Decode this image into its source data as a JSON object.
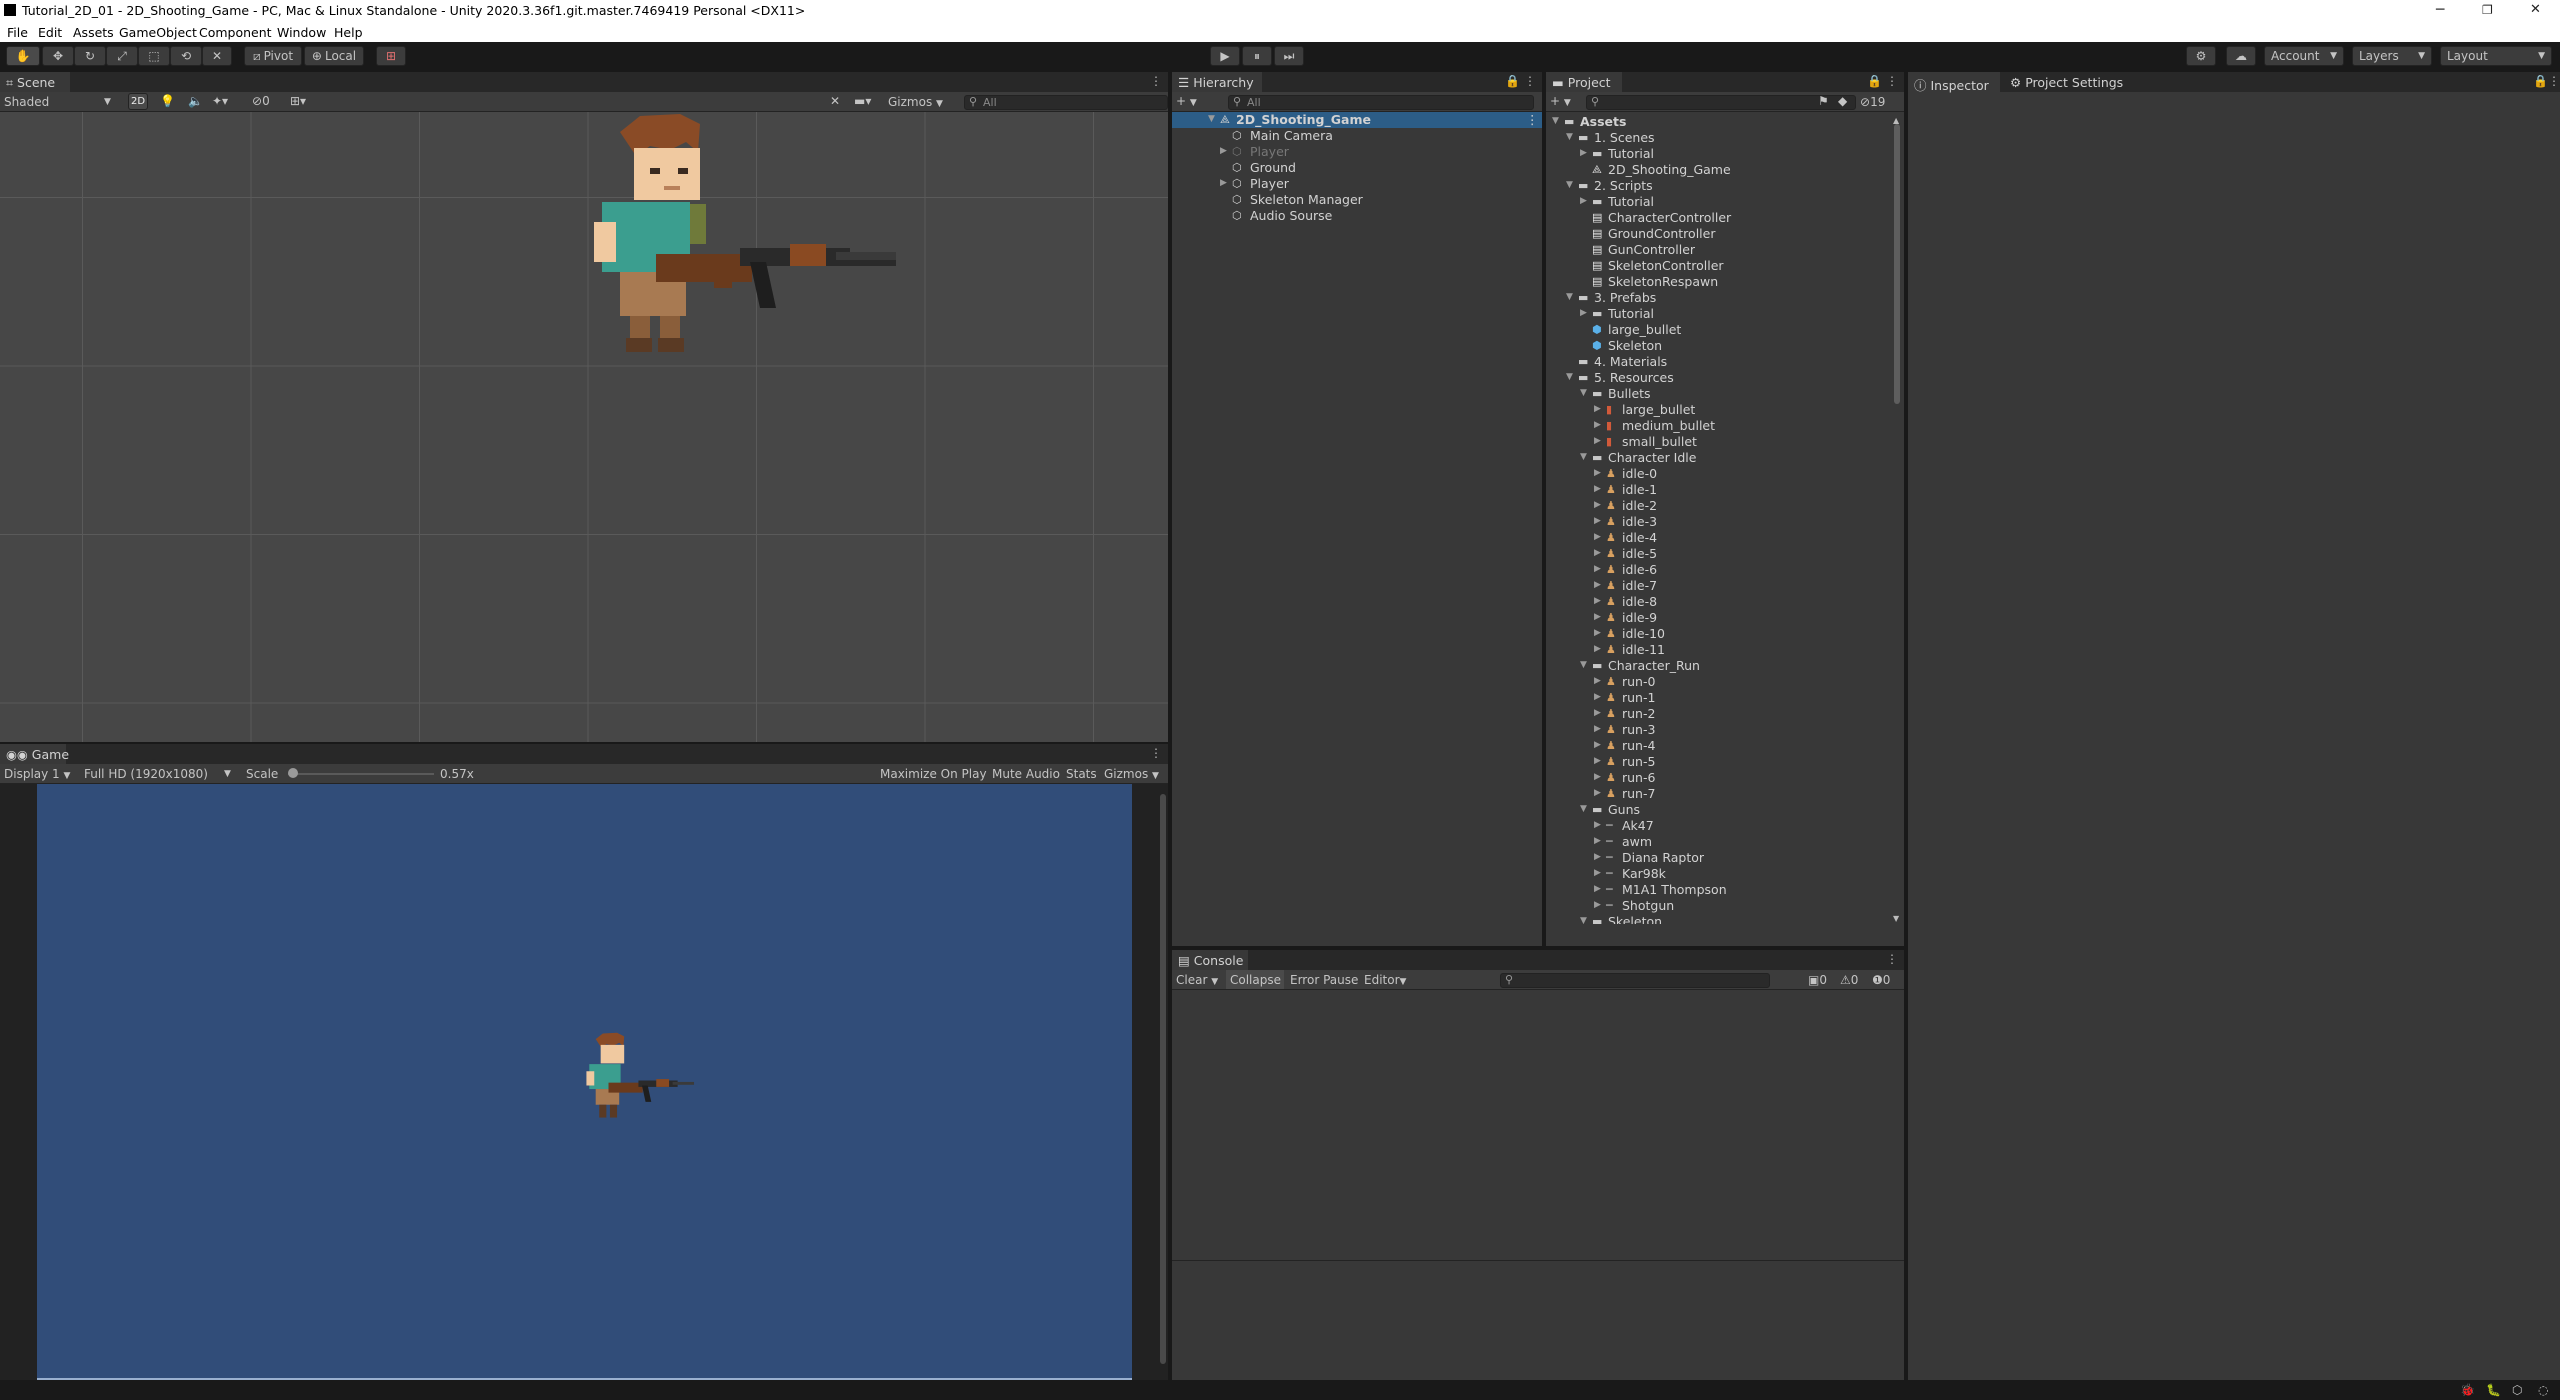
{
  "window": {
    "title": "Tutorial_2D_01 - 2D_Shooting_Game - PC, Mac & Linux Standalone - Unity 2020.3.36f1.git.master.7469419 Personal <DX11>",
    "minimize": "─",
    "restore": "❐",
    "close": "✕"
  },
  "menu": [
    "File",
    "Edit",
    "Assets",
    "GameObject",
    "Component",
    "Window",
    "Help"
  ],
  "toolbar": {
    "tools": [
      "hand-icon",
      "move-icon",
      "rotate-icon",
      "scale-icon",
      "rect-icon",
      "transform-icon",
      "custom-tool-icon"
    ],
    "pivot": "Pivot",
    "local": "Local",
    "grid_snap_icon": "grid-snap-icon",
    "play": "▶",
    "pause": "⏸",
    "step": "⏭",
    "account": "Account",
    "layers": "Layers",
    "layout": "Layout"
  },
  "scene": {
    "tab": "Scene",
    "shading": "Shaded",
    "mode_2d": "2D",
    "hidden_count": "0",
    "gizmos": "Gizmos",
    "search_placeholder": "All"
  },
  "game": {
    "tab": "Game",
    "display": "Display 1",
    "resolution": "Full HD (1920x1080)",
    "scale_label": "Scale",
    "scale_value": "0.57x",
    "maximize": "Maximize On Play",
    "mute": "Mute Audio",
    "stats": "Stats",
    "gizmos": "Gizmos",
    "bg_color": "#314d79"
  },
  "hierarchy": {
    "tab": "Hierarchy",
    "search_placeholder": "All",
    "scene_name": "2D_Shooting_Game",
    "items": [
      {
        "label": "Main Camera",
        "expand": false,
        "dim": false
      },
      {
        "label": "Player",
        "expand": true,
        "dim": true
      },
      {
        "label": "Ground",
        "expand": false,
        "dim": false
      },
      {
        "label": "Player",
        "expand": true,
        "dim": false
      },
      {
        "label": "Skeleton Manager",
        "expand": false,
        "dim": false
      },
      {
        "label": "Audio Sourse",
        "expand": false,
        "dim": false
      }
    ]
  },
  "project": {
    "tab": "Project",
    "hidden_count": "19",
    "tree": [
      {
        "d": 0,
        "a": "▼",
        "i": "folder",
        "t": "Assets",
        "b": true
      },
      {
        "d": 1,
        "a": "▼",
        "i": "folder",
        "t": "1. Scenes"
      },
      {
        "d": 2,
        "a": "▶",
        "i": "folder",
        "t": "Tutorial"
      },
      {
        "d": 2,
        "a": "",
        "i": "scene",
        "t": "2D_Shooting_Game"
      },
      {
        "d": 1,
        "a": "▼",
        "i": "folder",
        "t": "2. Scripts"
      },
      {
        "d": 2,
        "a": "▶",
        "i": "folder",
        "t": "Tutorial"
      },
      {
        "d": 2,
        "a": "",
        "i": "script",
        "t": "CharacterController"
      },
      {
        "d": 2,
        "a": "",
        "i": "script",
        "t": "GroundController"
      },
      {
        "d": 2,
        "a": "",
        "i": "script",
        "t": "GunController"
      },
      {
        "d": 2,
        "a": "",
        "i": "script",
        "t": "SkeletonController"
      },
      {
        "d": 2,
        "a": "",
        "i": "script",
        "t": "SkeletonRespawn"
      },
      {
        "d": 1,
        "a": "▼",
        "i": "folder",
        "t": "3. Prefabs"
      },
      {
        "d": 2,
        "a": "▶",
        "i": "folder",
        "t": "Tutorial"
      },
      {
        "d": 2,
        "a": "",
        "i": "prefab",
        "t": "large_bullet"
      },
      {
        "d": 2,
        "a": "",
        "i": "prefab",
        "t": "Skeleton"
      },
      {
        "d": 1,
        "a": "",
        "i": "folder",
        "t": "4. Materials"
      },
      {
        "d": 1,
        "a": "▼",
        "i": "folder",
        "t": "5. Resources"
      },
      {
        "d": 2,
        "a": "▼",
        "i": "folder",
        "t": "Bullets"
      },
      {
        "d": 3,
        "a": "▶",
        "i": "bullet",
        "t": "large_bullet"
      },
      {
        "d": 3,
        "a": "▶",
        "i": "bullet",
        "t": "medium_bullet"
      },
      {
        "d": 3,
        "a": "▶",
        "i": "bullet",
        "t": "small_bullet"
      },
      {
        "d": 2,
        "a": "▼",
        "i": "folder",
        "t": "Character Idle"
      },
      {
        "d": 3,
        "a": "▶",
        "i": "sprite",
        "t": "idle-0"
      },
      {
        "d": 3,
        "a": "▶",
        "i": "sprite",
        "t": "idle-1"
      },
      {
        "d": 3,
        "a": "▶",
        "i": "sprite",
        "t": "idle-2"
      },
      {
        "d": 3,
        "a": "▶",
        "i": "sprite",
        "t": "idle-3"
      },
      {
        "d": 3,
        "a": "▶",
        "i": "sprite",
        "t": "idle-4"
      },
      {
        "d": 3,
        "a": "▶",
        "i": "sprite",
        "t": "idle-5"
      },
      {
        "d": 3,
        "a": "▶",
        "i": "sprite",
        "t": "idle-6"
      },
      {
        "d": 3,
        "a": "▶",
        "i": "sprite",
        "t": "idle-7"
      },
      {
        "d": 3,
        "a": "▶",
        "i": "sprite",
        "t": "idle-8"
      },
      {
        "d": 3,
        "a": "▶",
        "i": "sprite",
        "t": "idle-9"
      },
      {
        "d": 3,
        "a": "▶",
        "i": "sprite",
        "t": "idle-10"
      },
      {
        "d": 3,
        "a": "▶",
        "i": "sprite",
        "t": "idle-11"
      },
      {
        "d": 2,
        "a": "▼",
        "i": "folder",
        "t": "Character_Run"
      },
      {
        "d": 3,
        "a": "▶",
        "i": "sprite",
        "t": "run-0"
      },
      {
        "d": 3,
        "a": "▶",
        "i": "sprite",
        "t": "run-1"
      },
      {
        "d": 3,
        "a": "▶",
        "i": "sprite",
        "t": "run-2"
      },
      {
        "d": 3,
        "a": "▶",
        "i": "sprite",
        "t": "run-3"
      },
      {
        "d": 3,
        "a": "▶",
        "i": "sprite",
        "t": "run-4"
      },
      {
        "d": 3,
        "a": "▶",
        "i": "sprite",
        "t": "run-5"
      },
      {
        "d": 3,
        "a": "▶",
        "i": "sprite",
        "t": "run-6"
      },
      {
        "d": 3,
        "a": "▶",
        "i": "sprite",
        "t": "run-7"
      },
      {
        "d": 2,
        "a": "▼",
        "i": "folder",
        "t": "Guns"
      },
      {
        "d": 3,
        "a": "▶",
        "i": "gun",
        "t": "Ak47"
      },
      {
        "d": 3,
        "a": "▶",
        "i": "gun",
        "t": "awm"
      },
      {
        "d": 3,
        "a": "▶",
        "i": "gun",
        "t": "Diana Raptor"
      },
      {
        "d": 3,
        "a": "▶",
        "i": "gun",
        "t": "Kar98k"
      },
      {
        "d": 3,
        "a": "▶",
        "i": "gun",
        "t": "M1A1 Thompson"
      },
      {
        "d": 3,
        "a": "▶",
        "i": "gun",
        "t": "Shotgun"
      },
      {
        "d": 2,
        "a": "▼",
        "i": "folder",
        "t": "Skeleton"
      }
    ]
  },
  "inspector": {
    "tab": "Inspector",
    "settings_tab": "Project Settings"
  },
  "console": {
    "tab": "Console",
    "clear": "Clear",
    "collapse": "Collapse",
    "error_pause": "Error Pause",
    "editor": "Editor",
    "logs": "0",
    "warnings": "0",
    "errors": "0"
  },
  "colors": {
    "panel": "#383838",
    "dark": "#191919",
    "tabstrip": "#282828"
  }
}
